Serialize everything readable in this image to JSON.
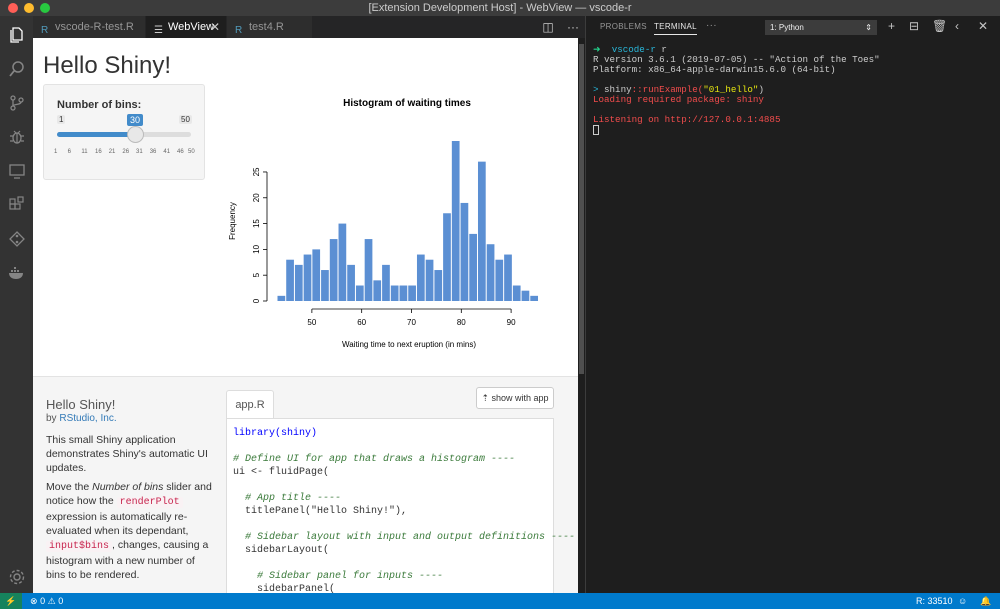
{
  "window": {
    "title": "[Extension Development Host] - WebView — vscode-r"
  },
  "colors": {
    "accent": "#007acc",
    "bar": "#5b8fd3",
    "slider": "#428bca"
  },
  "activity_icons": [
    "files-icon",
    "search-icon",
    "source-control-icon",
    "debug-icon",
    "remote-explorer-icon",
    "extensions-icon",
    "git-graph-icon",
    "docker-icon",
    "settings-gear-icon"
  ],
  "tabs": [
    {
      "label": "vscode-R-test.R",
      "icon": "r-file-icon"
    },
    {
      "label": "WebView",
      "icon": "preview-icon"
    },
    {
      "label": "test4.R",
      "icon": "r-file-icon"
    }
  ],
  "shiny": {
    "title": "Hello Shiny!",
    "slider": {
      "label": "Number of bins:",
      "min": 1,
      "max": 50,
      "value": 30,
      "min_label": "1",
      "max_label": "50",
      "value_label": "30",
      "ticks": [
        "1",
        "6",
        "11",
        "16",
        "21",
        "26",
        "31",
        "36",
        "41",
        "46",
        "50"
      ]
    }
  },
  "chart_data": {
    "type": "bar",
    "title": "Histogram of waiting times",
    "xlabel": "Waiting time to next eruption (in mins)",
    "ylabel": "Frequency",
    "x_start": 43,
    "bin_width": 1.75,
    "values": [
      1,
      8,
      7,
      9,
      10,
      6,
      12,
      15,
      7,
      3,
      12,
      4,
      7,
      3,
      3,
      3,
      9,
      8,
      6,
      17,
      31,
      19,
      13,
      27,
      11,
      8,
      9,
      3,
      2,
      1
    ],
    "xticks": [
      50,
      60,
      70,
      80,
      90
    ],
    "yticks": [
      0,
      5,
      10,
      15,
      20,
      25
    ],
    "xlim": [
      43,
      96
    ],
    "ylim": [
      0,
      31
    ]
  },
  "info": {
    "title": "Hello Shiny!",
    "by_prefix": "by",
    "author": "RStudio, Inc.",
    "p1": "This small Shiny application demonstrates Shiny's automatic UI updates.",
    "p2a": "Move the",
    "p2em": "Number of bins",
    "p2b": "slider and notice how the",
    "p2code": "renderPlot",
    "p2c": "expression is automatically re-evaluated when its dependant,",
    "p2code2": "input$bins",
    "p2d": ", changes, causing a histogram with a new number of bins to be rendered."
  },
  "code_panel": {
    "tab_label": "app.R",
    "show_button": "show with app",
    "lines": [
      "library(shiny)",
      "",
      "# Define UI for app that draws a histogram ----",
      "ui <- fluidPage(",
      "",
      "  # App title ----",
      "  titlePanel(\"Hello Shiny!\"),",
      "",
      "  # Sidebar layout with input and output definitions ----",
      "  sidebarLayout(",
      "",
      "    # Sidebar panel for inputs ----",
      "    sidebarPanel("
    ]
  },
  "panel": {
    "tabs": [
      "PROBLEMS",
      "TERMINAL"
    ],
    "more": "···",
    "terminal_select": "1: Python",
    "terminal": {
      "prompt_arrow": "➜",
      "prompt_dir": "vscode-r",
      "prompt_cmd": "r",
      "line1": "R version 3.6.1 (2019-07-05) -- \"Action of the Toes\"",
      "line2": "Platform: x86_64-apple-darwin15.6.0 (64-bit)",
      "cmd_prompt": ">",
      "cmd_pkg": "shiny",
      "cmd_fn": "::runExample(",
      "cmd_arg": "\"01_hello\"",
      "cmd_end": ")",
      "line4": "Loading required package: shiny",
      "line5": "Listening on http://127.0.0.1:4885"
    }
  },
  "status": {
    "errors": "0",
    "warnings": "0",
    "r_port": "R: 33510"
  }
}
